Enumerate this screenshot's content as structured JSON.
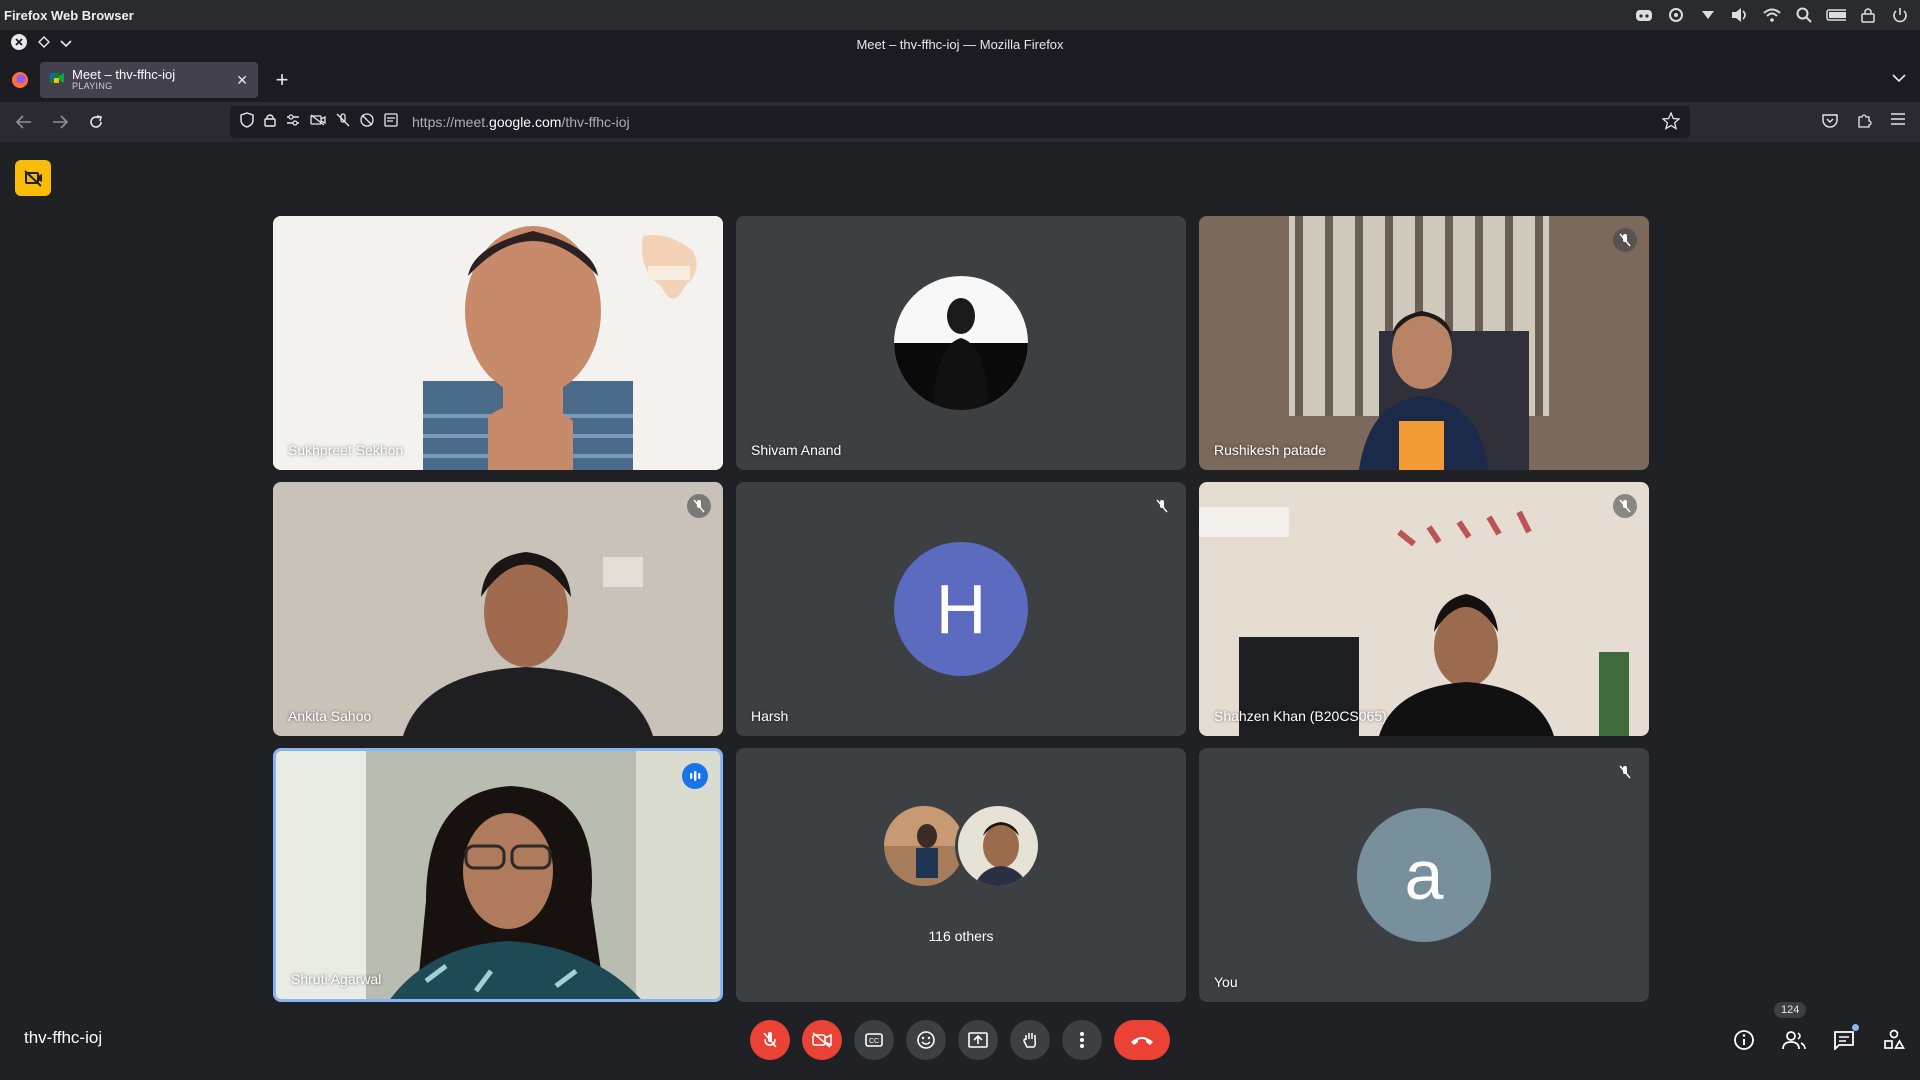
{
  "os": {
    "title": "Firefox Web Browser",
    "tray_icons": [
      "discord-icon",
      "sync-icon",
      "dropdown-icon",
      "volume-icon",
      "wifi-icon",
      "search-icon",
      "battery-icon",
      "lock-icon",
      "power-icon"
    ]
  },
  "browser": {
    "window_title": "Meet – thv-ffhc-ioj — Mozilla Firefox",
    "tab": {
      "title": "Meet – thv-ffhc-ioj",
      "subtitle": "PLAYING"
    },
    "url_prefix": "https://meet.",
    "url_host": "google.com",
    "url_path": "/thv-ffhc-ioj"
  },
  "meet": {
    "code": "thv-ffhc-ioj",
    "participant_count": "124",
    "tiles": [
      {
        "name": "Sukhpreet Sekhon",
        "muted": false
      },
      {
        "name": "Shivam Anand",
        "muted": false
      },
      {
        "name": "Rushikesh patade",
        "muted": true
      },
      {
        "name": "Ankita Sahoo",
        "muted": true
      },
      {
        "name": "Harsh",
        "avatar_letter": "H",
        "muted": true
      },
      {
        "name": "Shahzen Khan (B20CS065)",
        "muted": true
      },
      {
        "name": "Shruti Agarwal",
        "speaking": true
      },
      {
        "others_label": "116 others"
      },
      {
        "name": "You",
        "avatar_letter": "a",
        "muted": true
      }
    ],
    "colors": {
      "background": "#202124",
      "tile": "#3c4043",
      "harsh_avatar": "#5c6bc0",
      "you_avatar": "#78909c",
      "danger": "#ea4335",
      "speaking": "#1a73e8",
      "badge": "#fbbc04"
    },
    "controls": [
      "mic-off-icon",
      "camera-off-icon",
      "captions-icon",
      "emoji-icon",
      "present-icon",
      "raise-hand-icon",
      "more-options-icon",
      "hangup-icon"
    ],
    "right_controls": [
      "info-icon",
      "people-icon",
      "chat-icon",
      "activities-icon"
    ]
  }
}
